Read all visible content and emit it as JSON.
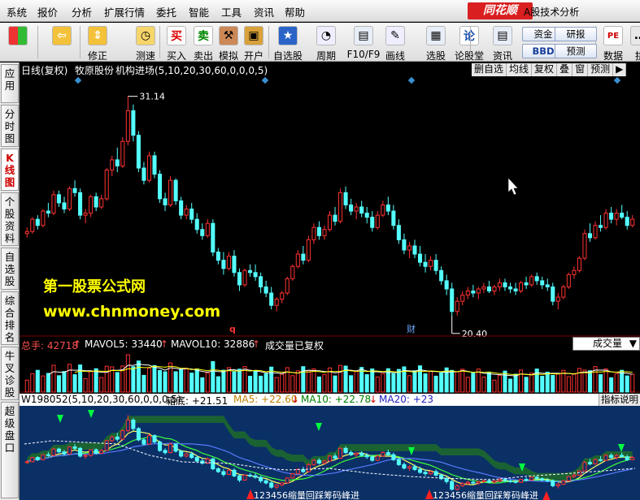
{
  "menubar": {
    "items": [
      "系统",
      "报价",
      "分析",
      "扩展行情",
      "委托",
      "智能",
      "工具",
      "资讯",
      "帮助"
    ],
    "logo": "同花顺",
    "app_title": "A股技术分析"
  },
  "toolbar": {
    "groups": [
      {
        "label": "",
        "icon": "windows-logo-icon"
      },
      {
        "label": "",
        "icon": "back-arrow-icon"
      },
      {
        "label": "修正",
        "icon": "up-down-arrows-icon"
      },
      {
        "label": "测速",
        "icon": "clock-icon"
      },
      {
        "label": "买入",
        "icon": "buy-icon",
        "glyph": "买"
      },
      {
        "label": "卖出",
        "icon": "sell-icon",
        "glyph": "卖"
      },
      {
        "label": "模拟",
        "icon": "hammer-icon"
      },
      {
        "label": "开户",
        "icon": "lock-icon"
      },
      {
        "label": "自选股",
        "icon": "star-icon"
      },
      {
        "label": "周期",
        "icon": "period-icon"
      },
      {
        "label": "F10/F9",
        "icon": "f10-icon"
      },
      {
        "label": "画线",
        "icon": "pencil-icon"
      },
      {
        "label": "选股",
        "icon": "screen-icon"
      },
      {
        "label": "论股堂",
        "icon": "forum-icon",
        "glyph": "论"
      },
      {
        "label": "资讯",
        "icon": "news-icon"
      },
      {
        "label": "数据",
        "icon": "pe-icon",
        "glyph": "PE"
      },
      {
        "label": "拱",
        "icon": "more-icon"
      }
    ],
    "mini_buttons": [
      "资金",
      "研报",
      "BBD",
      "预测"
    ]
  },
  "sidetabs": [
    "应用",
    "分时图",
    "K线图",
    "个股资料",
    "自选股",
    "综合排名",
    "牛叉诊股",
    "超级盘口"
  ],
  "sidetab_active": "K线图",
  "chart": {
    "header": {
      "period": "日线(复权)",
      "stock": "牧原股份",
      "formula": "机构进场(5,10,20,30,60,0,0,0,5)"
    },
    "right_buttons": [
      "删自选",
      "均线",
      "复权",
      "叠",
      "窗",
      "预测",
      "▶"
    ],
    "price_high_label": "31.14",
    "price_low_label": "20.40",
    "marker_q": "q",
    "marker_cai": "财",
    "watermark_1": "第一股票公式网",
    "watermark_2": "www.chnmoney.com",
    "volume_header": {
      "total": "总手: 42718",
      "mavol5": "MAVOL5: 33440",
      "mavol10": "MAVOL10: 32886",
      "note": "成交量已复权"
    },
    "volume_select": "成交量",
    "indicator_header": {
      "formula": "W198052(5,10,20,30,60,0,0,0,5)",
      "box_bottom": "箱底: +21.51",
      "ma5": "MA5: +22.60",
      "ma10": "MA10: +22.78",
      "ma20": "MA20: +23",
      "explain_button": "指标说明"
    },
    "indicator_signals": [
      "123456缩量回踩筹码峰进",
      "123456缩量回踩筹码峰进"
    ],
    "colors": {
      "up": "#ff3232",
      "down": "#54ffff",
      "header_red": "#ff5050",
      "indicator_bg": "#0a3066",
      "band_green": "#1f6b2a",
      "signal_arrow": "#00ff40"
    }
  },
  "chart_data": {
    "type": "candlestick",
    "price_range": [
      19.6,
      31.8
    ],
    "candles": [
      [
        24.4,
        24.7,
        24.2,
        24.5
      ],
      [
        24.5,
        25.2,
        24.4,
        25.1
      ],
      [
        25.1,
        25.3,
        24.6,
        24.8
      ],
      [
        24.8,
        25.6,
        24.7,
        25.5
      ],
      [
        25.5,
        25.9,
        25.2,
        25.4
      ],
      [
        25.4,
        26.5,
        25.3,
        26.3
      ],
      [
        26.3,
        26.5,
        25.7,
        25.9
      ],
      [
        25.9,
        26.2,
        25.4,
        25.6
      ],
      [
        25.6,
        26.7,
        25.5,
        26.6
      ],
      [
        26.6,
        27.0,
        26.2,
        26.4
      ],
      [
        26.4,
        26.6,
        25.1,
        25.3
      ],
      [
        25.3,
        25.6,
        24.9,
        25.4
      ],
      [
        25.4,
        26.3,
        25.2,
        26.2
      ],
      [
        26.2,
        26.4,
        25.5,
        25.7
      ],
      [
        25.7,
        26.3,
        25.6,
        26.1
      ],
      [
        26.1,
        27.6,
        26.0,
        27.5
      ],
      [
        27.5,
        28.2,
        27.2,
        28.0
      ],
      [
        28.0,
        28.6,
        27.4,
        27.7
      ],
      [
        27.7,
        29.1,
        27.6,
        28.9
      ],
      [
        28.9,
        31.1,
        28.7,
        30.4
      ],
      [
        30.4,
        30.7,
        28.9,
        29.2
      ],
      [
        29.2,
        29.4,
        27.4,
        27.6
      ],
      [
        27.6,
        27.9,
        26.8,
        27.0
      ],
      [
        27.0,
        28.4,
        26.9,
        28.2
      ],
      [
        28.2,
        28.4,
        27.1,
        27.3
      ],
      [
        27.3,
        27.5,
        25.9,
        26.1
      ],
      [
        26.1,
        26.4,
        25.5,
        25.8
      ],
      [
        25.8,
        27.2,
        25.7,
        27.0
      ],
      [
        27.0,
        27.1,
        25.8,
        26.0
      ],
      [
        26.0,
        26.2,
        25.1,
        25.3
      ],
      [
        25.3,
        25.8,
        25.1,
        25.6
      ],
      [
        25.6,
        25.9,
        24.9,
        25.1
      ],
      [
        25.1,
        25.4,
        24.4,
        24.6
      ],
      [
        24.6,
        24.9,
        24.1,
        24.3
      ],
      [
        24.3,
        25.1,
        24.2,
        24.9
      ],
      [
        24.9,
        25.1,
        23.3,
        23.5
      ],
      [
        23.5,
        23.7,
        22.9,
        23.1
      ],
      [
        23.1,
        23.5,
        22.4,
        22.7
      ],
      [
        22.7,
        23.5,
        22.6,
        23.3
      ],
      [
        23.3,
        23.6,
        22.3,
        22.5
      ],
      [
        22.5,
        22.7,
        21.6,
        21.9
      ],
      [
        21.9,
        22.7,
        21.8,
        22.6
      ],
      [
        22.6,
        22.9,
        22.3,
        22.5
      ],
      [
        22.5,
        22.9,
        22.1,
        22.3
      ],
      [
        22.3,
        22.5,
        21.5,
        21.8
      ],
      [
        21.8,
        22.1,
        21.3,
        21.5
      ],
      [
        21.5,
        21.8,
        20.7,
        20.9
      ],
      [
        20.9,
        21.3,
        20.6,
        21.2
      ],
      [
        21.2,
        21.6,
        21.0,
        21.5
      ],
      [
        21.5,
        22.3,
        21.4,
        22.2
      ],
      [
        22.2,
        22.9,
        22.1,
        22.8
      ],
      [
        22.8,
        23.6,
        22.7,
        23.4
      ],
      [
        23.4,
        23.8,
        22.9,
        23.1
      ],
      [
        23.1,
        24.3,
        23.0,
        24.1
      ],
      [
        24.1,
        24.9,
        23.9,
        24.7
      ],
      [
        24.7,
        25.0,
        24.1,
        24.3
      ],
      [
        24.3,
        24.8,
        24.1,
        24.6
      ],
      [
        24.6,
        25.5,
        24.5,
        25.3
      ],
      [
        25.3,
        25.7,
        24.8,
        25.0
      ],
      [
        25.0,
        26.6,
        24.9,
        26.4
      ],
      [
        26.4,
        26.7,
        25.6,
        25.8
      ],
      [
        25.8,
        26.1,
        25.3,
        25.5
      ],
      [
        25.5,
        25.9,
        25.1,
        25.7
      ],
      [
        25.7,
        26.0,
        25.2,
        25.4
      ],
      [
        25.4,
        25.7,
        24.9,
        25.2
      ],
      [
        25.2,
        25.5,
        24.5,
        24.7
      ],
      [
        24.7,
        25.5,
        24.6,
        25.3
      ],
      [
        25.3,
        26.0,
        25.2,
        25.8
      ],
      [
        25.8,
        26.2,
        25.3,
        25.5
      ],
      [
        25.5,
        25.8,
        24.6,
        24.8
      ],
      [
        24.8,
        25.1,
        23.9,
        24.1
      ],
      [
        24.1,
        24.4,
        23.4,
        23.6
      ],
      [
        23.6,
        24.0,
        23.2,
        23.8
      ],
      [
        23.8,
        24.1,
        23.2,
        23.4
      ],
      [
        23.4,
        23.8,
        22.8,
        23.0
      ],
      [
        23.0,
        23.4,
        22.5,
        22.8
      ],
      [
        22.8,
        23.3,
        22.6,
        23.1
      ],
      [
        23.1,
        23.4,
        22.4,
        22.6
      ],
      [
        22.6,
        22.8,
        21.9,
        22.1
      ],
      [
        22.1,
        22.4,
        21.4,
        21.7
      ],
      [
        21.7,
        22.0,
        20.4,
        20.6
      ],
      [
        20.6,
        21.3,
        20.4,
        21.1
      ],
      [
        21.1,
        21.6,
        20.9,
        21.4
      ],
      [
        21.4,
        21.8,
        21.2,
        21.6
      ],
      [
        21.6,
        21.9,
        21.3,
        21.5
      ],
      [
        21.5,
        21.8,
        21.2,
        21.7
      ],
      [
        21.7,
        22.0,
        21.5,
        21.8
      ],
      [
        21.8,
        22.1,
        21.5,
        21.6
      ],
      [
        21.6,
        21.9,
        21.4,
        21.8
      ],
      [
        21.8,
        22.2,
        21.6,
        22.0
      ],
      [
        22.0,
        22.2,
        21.6,
        21.8
      ],
      [
        21.8,
        22.0,
        21.5,
        21.7
      ],
      [
        21.7,
        22.0,
        21.4,
        21.6
      ],
      [
        21.6,
        22.1,
        21.5,
        22.0
      ],
      [
        22.0,
        22.3,
        21.7,
        21.9
      ],
      [
        21.9,
        22.4,
        21.8,
        22.3
      ],
      [
        22.3,
        22.5,
        21.9,
        22.1
      ],
      [
        22.1,
        22.3,
        21.7,
        21.9
      ],
      [
        21.9,
        22.2,
        21.6,
        21.8
      ],
      [
        21.8,
        22.0,
        20.9,
        21.1
      ],
      [
        21.1,
        21.5,
        20.7,
        21.3
      ],
      [
        21.3,
        21.9,
        21.2,
        21.8
      ],
      [
        21.8,
        22.5,
        21.7,
        22.4
      ],
      [
        22.4,
        22.8,
        22.2,
        22.6
      ],
      [
        22.6,
        23.3,
        22.5,
        23.2
      ],
      [
        23.2,
        24.6,
        23.1,
        24.4
      ],
      [
        24.4,
        24.9,
        24.0,
        24.2
      ],
      [
        24.2,
        25.0,
        24.1,
        24.8
      ],
      [
        24.8,
        25.3,
        24.5,
        24.7
      ],
      [
        24.7,
        25.6,
        24.6,
        25.4
      ],
      [
        25.4,
        25.7,
        24.9,
        25.1
      ],
      [
        25.1,
        25.6,
        24.8,
        25.4
      ],
      [
        25.4,
        25.8,
        25.1,
        25.2
      ],
      [
        25.2,
        25.5,
        24.6,
        24.8
      ],
      [
        24.8,
        25.3,
        24.7,
        25.1
      ]
    ]
  }
}
